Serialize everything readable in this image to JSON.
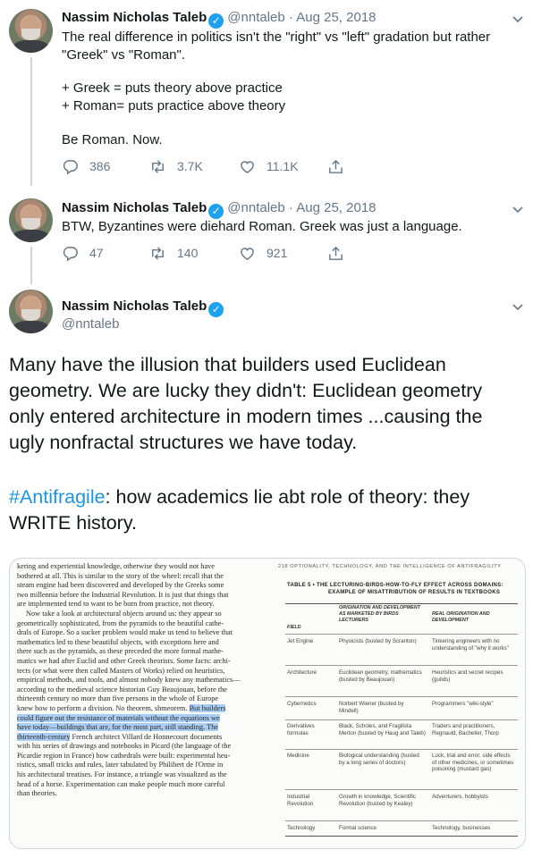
{
  "tweets": [
    {
      "author_name": "Nassim Nicholas Taleb",
      "handle": "@nntaleb",
      "separator": "·",
      "date": "Aug 25, 2018",
      "lines": [
        "The real difference in politics isn't the \"right\" vs \"left\" gradation but rather",
        "\"Greek\" vs \"Roman\".",
        "",
        "+ Greek = puts theory above practice",
        "+ Roman= puts practice above theory",
        "",
        "Be Roman. Now."
      ],
      "replies": "386",
      "retweets": "3.7K",
      "likes": "11.1K"
    },
    {
      "author_name": "Nassim Nicholas Taleb",
      "handle": "@nntaleb",
      "separator": "·",
      "date": "Aug 25, 2018",
      "lines": [
        "BTW, Byzantines were diehard Roman. Greek was just a language."
      ],
      "replies": "47",
      "retweets": "140",
      "likes": "921"
    }
  ],
  "main_tweet": {
    "author_name": "Nassim Nicholas Taleb",
    "handle": "@nntaleb",
    "lines": [
      "Many have the illusion that builders used Euclidean",
      "geometry. We are lucky they didn't: Euclidean geometry",
      "only entered architecture in modern times ...causing the",
      "ugly nonfractal structures we have today."
    ],
    "hashtag": "#Antifragile",
    "line2_rest": ": how academics lie abt role of theory: they",
    "line2_end": "WRITE history."
  },
  "book_left": {
    "lines": [
      "kering and experiential knowledge, otherwise they would not have",
      "bothered at all. This is similar to the story of the wheel: recall that the",
      "steam engine had been discovered and developed by the Greeks some",
      "two millennia before the Industrial Revolution. It is just that things that",
      "are implemented tend to want to be born from practice, not theory.",
      "Now take a look at architectural objects around us: they appear so",
      "geometrically sophisticated, from the pyramids to the beautiful cathe-",
      "drals of Europe. So a sucker problem would make us tend to believe that",
      "mathematics led to these beautiful objects, with exceptions here and",
      "there such as the pyramids, as these preceded the more formal mathe-",
      "matics we had after Euclid and other Greek theorists. Some facts: archi-",
      "tects (or what were then called Masters of Works) relied on heuristics,",
      "empirical methods, and tools, and almost nobody knew any mathematics—",
      "according to the medieval science historian Guy Beaujouan, before the",
      "thirteenth century no more than five persons in the whole of Europe",
      "knew how to perform a division. No theorem, shmeorem.",
      "could figure out the resistance of materials without the equations we",
      "have today—buildings that are, for the most part, still standing. The",
      "thirteenth-century",
      "with his series of drawings and notebooks in Picard (the language of the",
      "Picardie region in France) how cathedrals were built: experimental heu-",
      "ristics, small tricks and rules, later tabulated by Philibert de l'Orme in",
      "his architectural treatises. For instance, a triangle was visualized as the",
      "head of a horse. Experimentation can make people much more careful",
      "than theories."
    ],
    "hl_start": "But builders",
    "hl_line19_rest": " French architect Villard de Honnecourt documents"
  },
  "book_right": {
    "running_head": "218  OPTIONALITY, TECHNOLOGY, AND THE INTELLIGENCE OF ANTIFRAGILITY",
    "table_title": "TABLE 5 •  THE LECTURING-BIRDS-HOW-TO-FLY EFFECT ACROSS DOMAINS:",
    "table_subtitle": "EXAMPLE OF MISATTRIBUTION OF RESULTS IN TEXTBOOKS",
    "headers": [
      "FIELD",
      "ORIGINATION AND DEVELOPMENT AS MARKETED BY BIRDS LECTURERS",
      "REAL ORIGINATION AND DEVELOPMENT"
    ],
    "rows": [
      [
        "Jet Engine",
        "Physicists (busted by Scranton)",
        "Tinkering engineers with no understanding of \"why it works\""
      ],
      [
        "Architecture",
        "Euclidean geometry, mathematics (busted by Beaujouan)",
        "Heuristics and secret recipes (guilds)"
      ],
      [
        "Cybernetics",
        "Norbert Wiener (busted by Mindell)",
        "Programmers \"wiki-style\""
      ],
      [
        "Derivatives formulas",
        "Black, Scholes, and Fragilista Merton (busted by Haug and Taleb)",
        "Traders and practitioners, Regnauld, Bachelier, Thorp"
      ],
      [
        "Medicine",
        "Biological understanding (busted by a long series of doctors)",
        "Luck, trial and error, side effects of other medicines, or sometimes poisoning (mustard gas)"
      ],
      [
        "Industrial Revolution",
        "Growth in knowledge, Scientific Revolution (busted by Kealey)",
        "Adventurers, hobbyists"
      ],
      [
        "Technology",
        "Formal science",
        "Technology, businesses"
      ]
    ]
  }
}
